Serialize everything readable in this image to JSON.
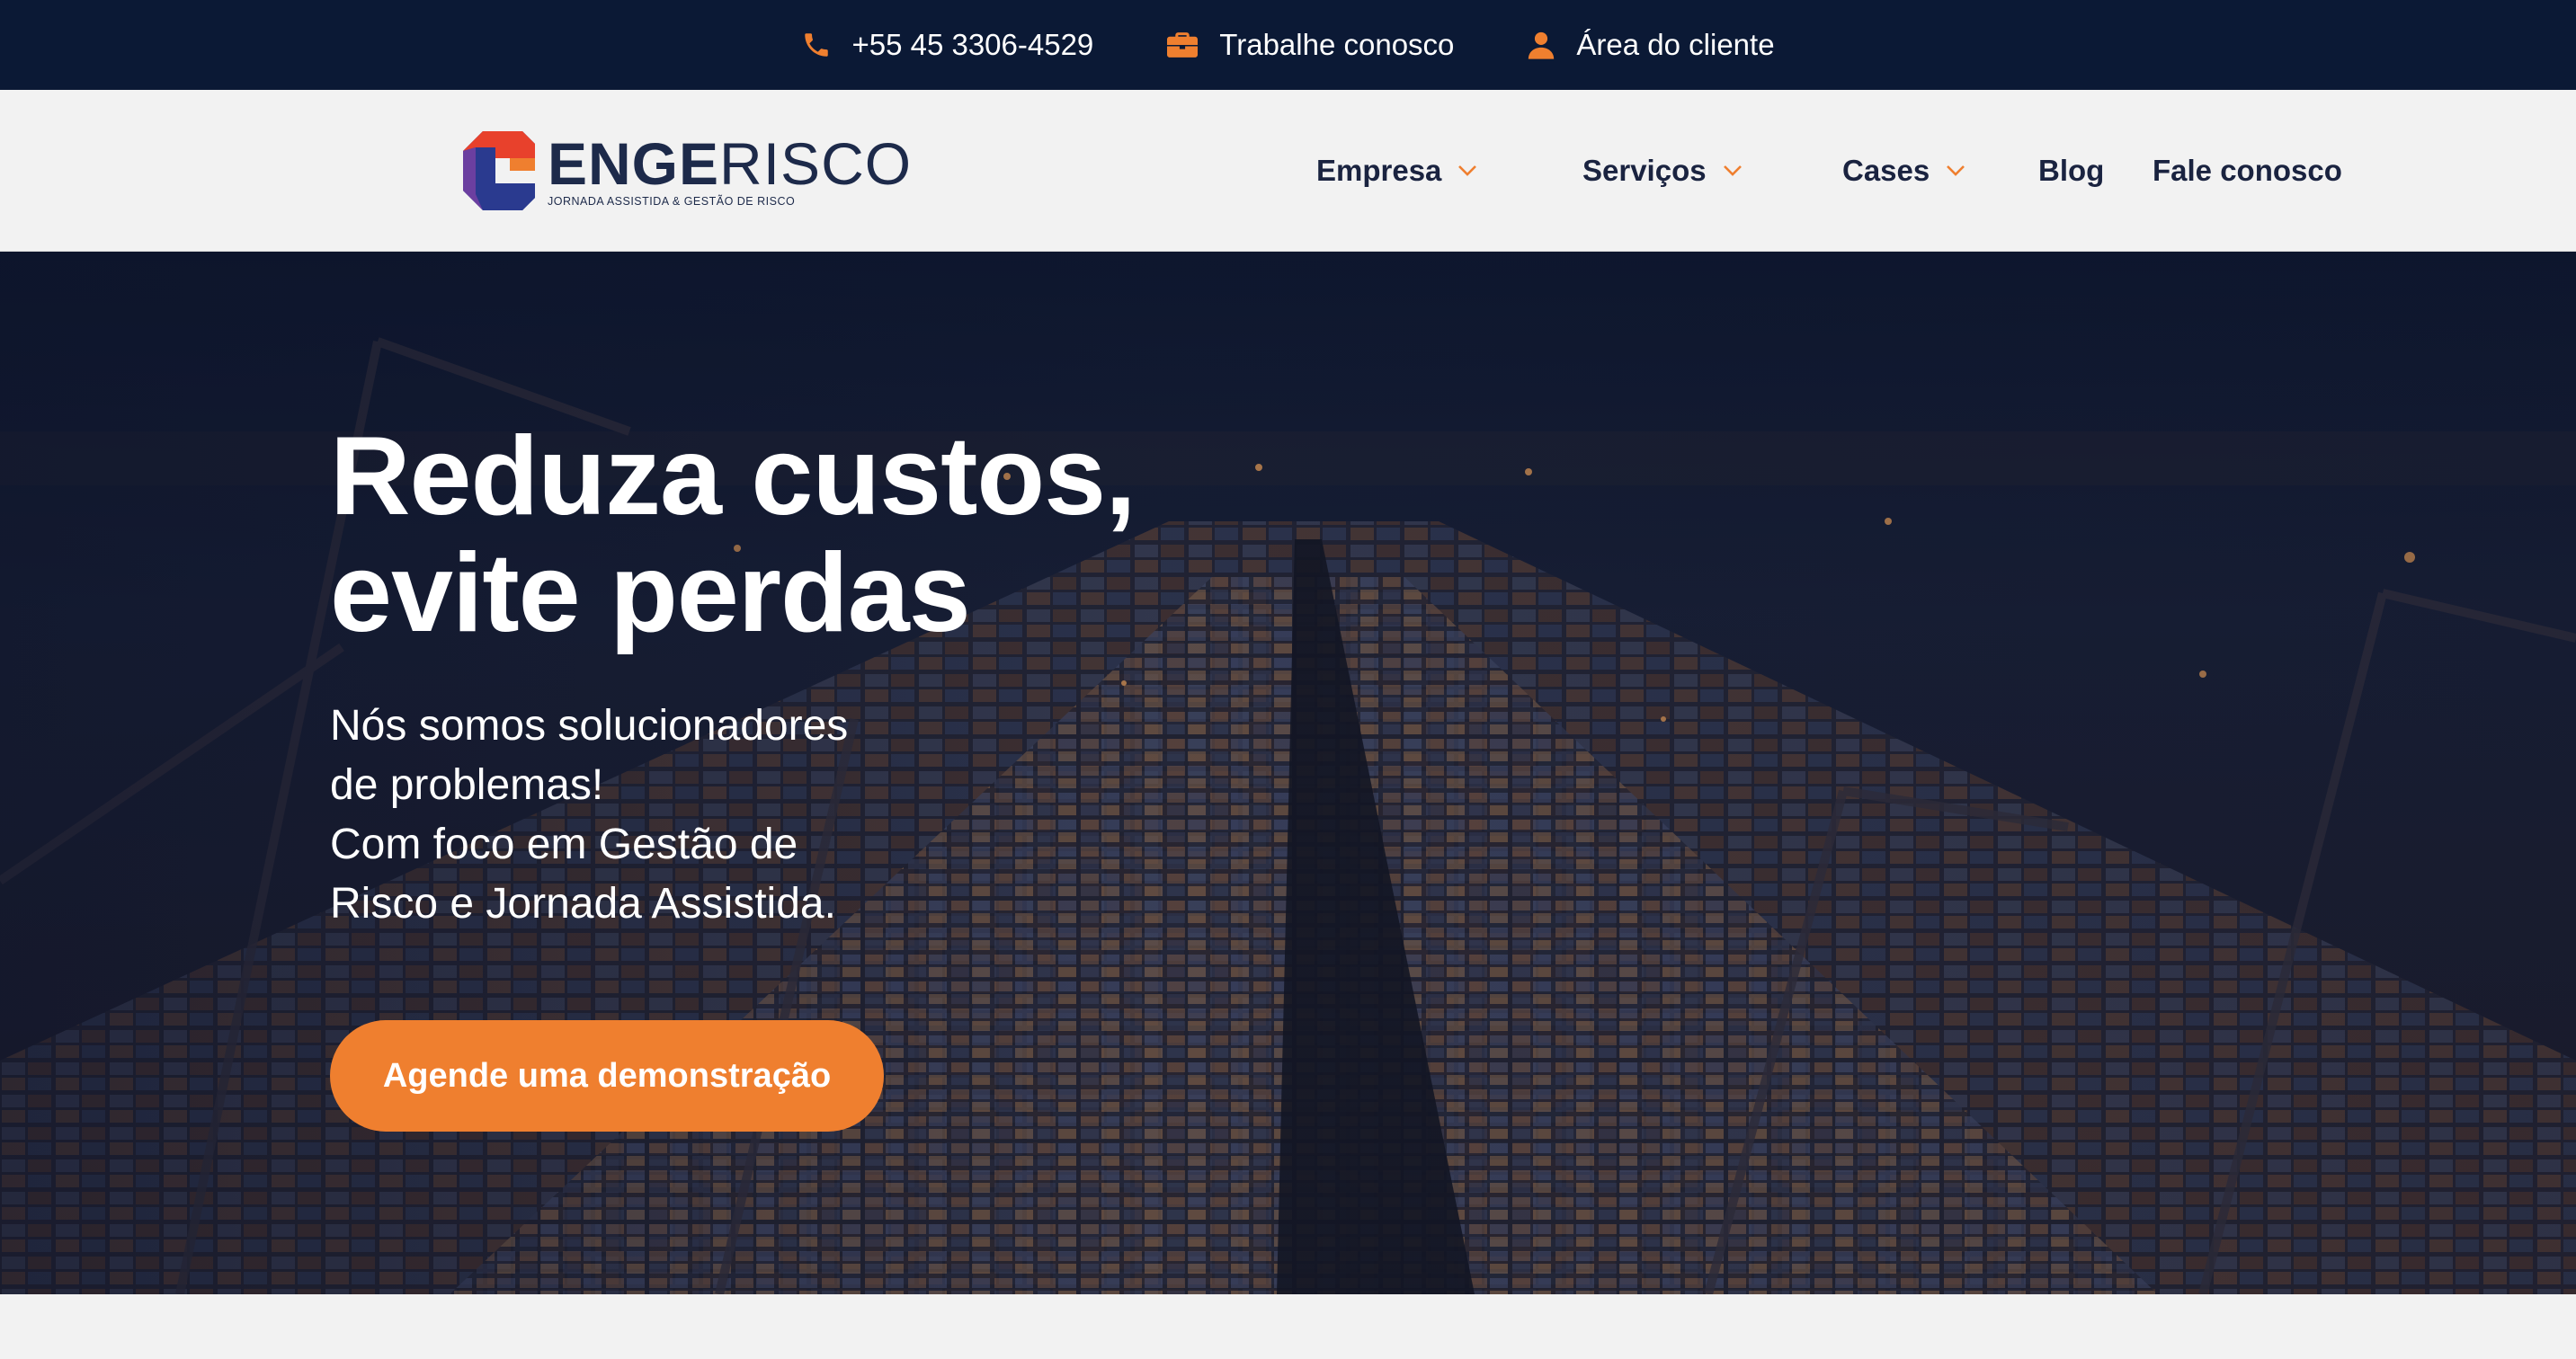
{
  "topbar": {
    "phone": "+55 45 3306-4529",
    "careers": "Trabalhe conosco",
    "client_area": "Área do cliente"
  },
  "logo": {
    "word_bold": "ENGE",
    "word_light": "RISCO",
    "tagline": "JORNADA ASSISTIDA & GESTÃO DE RISCO"
  },
  "nav": {
    "empresa": "Empresa",
    "servicos": "Serviços",
    "cases": "Cases",
    "blog": "Blog",
    "contato": "Fale conosco"
  },
  "hero": {
    "title_line1": "Reduza custos,",
    "title_line2": "evite perdas",
    "sub_line1": "Nós somos solucionadores",
    "sub_line2": "de problemas!",
    "sub_line3": "Com foco em Gestão de",
    "sub_line4": "Risco e Jornada Assistida.",
    "cta": "Agende uma demonstração"
  },
  "colors": {
    "topbar_bg": "#0b1935",
    "accent": "#ef7f2f",
    "nav_text": "#1a2340"
  },
  "icons": {
    "phone": "phone-icon",
    "careers": "briefcase-icon",
    "client": "user-icon",
    "dropdown": "chevron-down-icon"
  }
}
